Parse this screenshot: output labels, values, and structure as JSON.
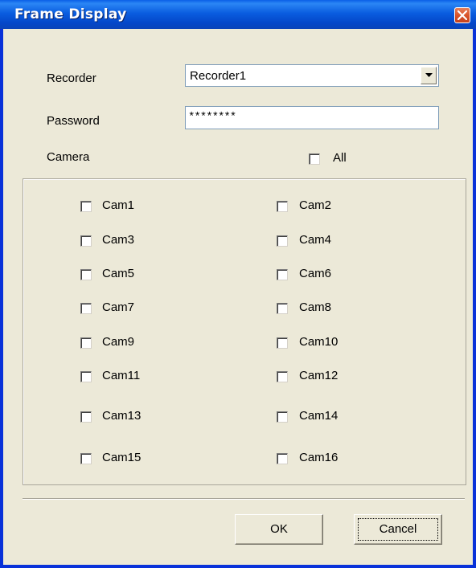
{
  "window": {
    "title": "Frame Display",
    "close_icon": "close-icon"
  },
  "form": {
    "recorder_label": "Recorder",
    "recorder_value": "Recorder1",
    "password_label": "Password",
    "password_value": "********",
    "camera_label": "Camera",
    "all_label": "All",
    "all_checked": false
  },
  "cameras": [
    {
      "label": "Cam1",
      "checked": false
    },
    {
      "label": "Cam2",
      "checked": false
    },
    {
      "label": "Cam3",
      "checked": false
    },
    {
      "label": "Cam4",
      "checked": false
    },
    {
      "label": "Cam5",
      "checked": false
    },
    {
      "label": "Cam6",
      "checked": false
    },
    {
      "label": "Cam7",
      "checked": false
    },
    {
      "label": "Cam8",
      "checked": false
    },
    {
      "label": "Cam9",
      "checked": false
    },
    {
      "label": "Cam10",
      "checked": false
    },
    {
      "label": "Cam11",
      "checked": false
    },
    {
      "label": "Cam12",
      "checked": false
    },
    {
      "label": "Cam13",
      "checked": false
    },
    {
      "label": "Cam14",
      "checked": false
    },
    {
      "label": "Cam15",
      "checked": false
    },
    {
      "label": "Cam16",
      "checked": false
    }
  ],
  "buttons": {
    "ok": "OK",
    "cancel": "Cancel"
  }
}
